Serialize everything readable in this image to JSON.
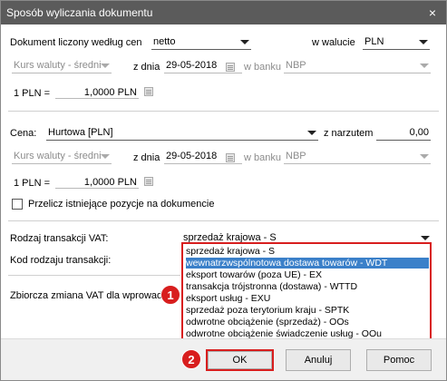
{
  "window": {
    "title": "Sposób wyliczania dokumentu",
    "close": "×"
  },
  "section1": {
    "label": "Dokument liczony według cen",
    "price_basis": "netto",
    "currency_label": "w walucie",
    "currency": "PLN",
    "rate_type": "Kurs waluty - średni",
    "date_label": "z dnia",
    "date": "29-05-2018",
    "bank_label": "w banku",
    "bank": "NBP",
    "rate_left": "1 PLN =",
    "rate_value": "1,0000 PLN"
  },
  "section2": {
    "price_label": "Cena:",
    "price": "Hurtowa [PLN]",
    "markup_label": "z narzutem",
    "markup_value": "0,00",
    "rate_type": "Kurs waluty - średni",
    "date_label": "z dnia",
    "date": "29-05-2018",
    "bank_label": "w banku",
    "bank": "NBP",
    "rate_left": "1 PLN =",
    "rate_value": "1,0000 PLN"
  },
  "recalc": {
    "label": "Przelicz istniejące pozycje na dokumencie"
  },
  "vat": {
    "type_label": "Rodzaj transakcji VAT:",
    "type_value": "sprzedaż krajowa - S",
    "code_label": "Kod rodzaju transakcji:",
    "summary_label": "Zbiorcza zmiana VAT dla wprowadzo",
    "options": [
      "sprzedaż krajowa - S",
      "wewnatrzwspólnotowa dostawa towarów - WDT",
      "eksport towarów (poza UE) - EX",
      "transakcja trójstronna (dostawa) - WTTD",
      "eksport usług - EXU",
      "sprzedaż poza terytorium kraju - SPTK",
      "odwrotne obciążenie (sprzedaż) - OOs",
      "odwrotne obciążenie świadczenie usług - OOu"
    ],
    "selected_index": 1
  },
  "buttons": {
    "ok": "OK",
    "cancel": "Anuluj",
    "help": "Pomoc"
  },
  "badges": {
    "one": "1",
    "two": "2"
  },
  "colors": {
    "highlight": "#d81e1e",
    "selection": "#3b80c9",
    "titlebar": "#5b5b5b"
  }
}
